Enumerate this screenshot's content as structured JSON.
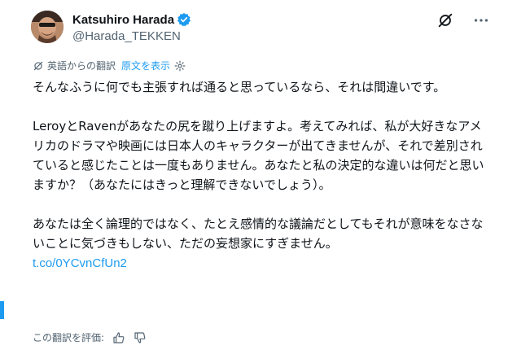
{
  "author": {
    "display_name": "Katsuhiro Harada",
    "handle": "@Harada_TEKKEN"
  },
  "translation": {
    "label": "英語からの翻訳",
    "show_original": "原文を表示"
  },
  "body": {
    "paragraph_1": "そんなふうに何でも主張すれば通ると思っているなら、それは間違いです。",
    "paragraph_2": "LeroyとRavenがあなたの尻を蹴り上げますよ。考えてみれば、私が大好きなアメリカのドラマや映画には日本人のキャラクターが出てきませんが、それで差別されていると感じたことは一度もありません。あなたと私の決定的な違いは何だと思いますか？（あなたにはきっと理解できないでしょう）。",
    "paragraph_3": "あなたは全く論理的ではなく、たとえ感情的な議論だとしてもそれが意味をなさないことに気づきもしない、ただの妄想家にすぎません。",
    "link": "t.co/0YCvnCfUn2"
  },
  "rating": {
    "label": "この翻訳を評価:"
  },
  "colors": {
    "accent": "#1d9bf0",
    "text": "#0f1419",
    "muted": "#536471"
  },
  "icons": {
    "verified": "verified-badge-icon",
    "grok": "grok-icon",
    "more": "more-icon",
    "translate": "translate-icon",
    "settings": "gear-icon",
    "thumb_up": "thumbs-up-icon",
    "thumb_down": "thumbs-down-icon"
  }
}
